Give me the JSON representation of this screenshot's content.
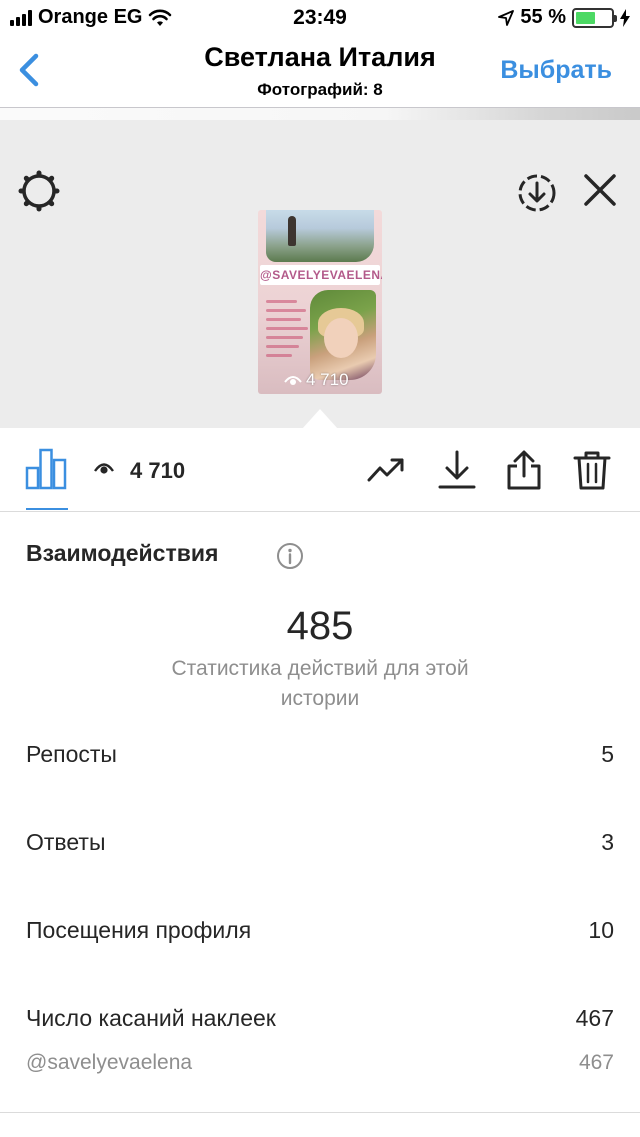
{
  "status_bar": {
    "carrier": "Orange EG",
    "time": "23:49",
    "battery_percent": "55 %",
    "battery_level": 0.55,
    "battery_color": "#4cd964"
  },
  "nav": {
    "title": "Светлана Италия",
    "subtitle": "Фотографий: 8",
    "action": "Выбрать",
    "accent": "#3b8fe0"
  },
  "story": {
    "handle": "@SAVELYEVAELENA",
    "views": "4 710"
  },
  "toolbar": {
    "views": "4 710",
    "icons": [
      "bar-chart-icon",
      "eye-icon",
      "trending-icon",
      "download-icon",
      "share-icon",
      "trash-icon"
    ]
  },
  "interactions": {
    "title": "Взаимодействия",
    "total": "485",
    "description": "Статистика действий для этой истории",
    "metrics": [
      {
        "label": "Репосты",
        "value": "5"
      },
      {
        "label": "Ответы",
        "value": "3"
      },
      {
        "label": "Посещения профиля",
        "value": "10"
      },
      {
        "label": "Число касаний наклеек",
        "value": "467"
      }
    ],
    "sticker": {
      "label": "@savelyevaelena",
      "value": "467"
    }
  }
}
